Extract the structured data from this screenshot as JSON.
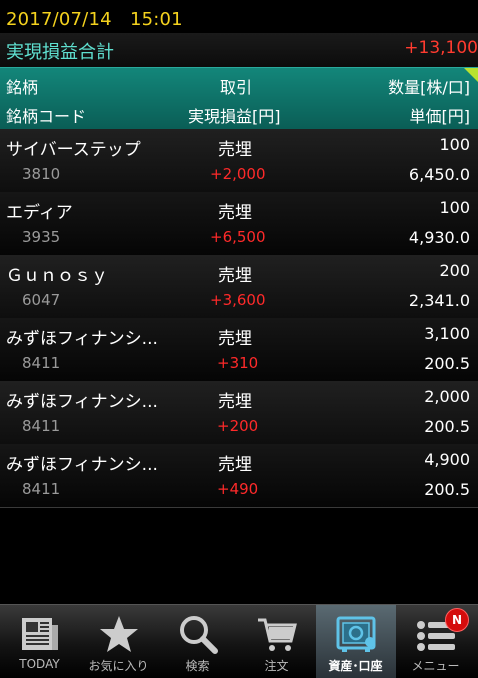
{
  "datetime": "2017/07/14　15:01",
  "summary": {
    "label": "実現損益合計",
    "value": "+13,100"
  },
  "header": {
    "col1_top": "銘柄",
    "col2_top": "取引",
    "col3_top": "数量[株/口]",
    "col1_bottom": "銘柄コード",
    "col2_bottom": "実現損益[円]",
    "col3_bottom": "単価[円]"
  },
  "rows": [
    {
      "name": "サイバーステップ",
      "trade": "売埋",
      "qty": "100",
      "code": "3810",
      "pl": "+2,000",
      "price": "6,450.0"
    },
    {
      "name": "エディア",
      "trade": "売埋",
      "qty": "100",
      "code": "3935",
      "pl": "+6,500",
      "price": "4,930.0"
    },
    {
      "name": "Ｇｕｎｏｓｙ",
      "trade": "売埋",
      "qty": "200",
      "code": "6047",
      "pl": "+3,600",
      "price": "2,341.0"
    },
    {
      "name": "みずほフィナンシ...",
      "trade": "売埋",
      "qty": "3,100",
      "code": "8411",
      "pl": "+310",
      "price": "200.5"
    },
    {
      "name": "みずほフィナンシ...",
      "trade": "売埋",
      "qty": "2,000",
      "code": "8411",
      "pl": "+200",
      "price": "200.5"
    },
    {
      "name": "みずほフィナンシ...",
      "trade": "売埋",
      "qty": "4,900",
      "code": "8411",
      "pl": "+490",
      "price": "200.5"
    }
  ],
  "tabs": [
    {
      "label": "TODAY",
      "icon": "newspaper-icon"
    },
    {
      "label": "お気に入り",
      "icon": "star-icon"
    },
    {
      "label": "検索",
      "icon": "search-icon"
    },
    {
      "label": "注文",
      "icon": "cart-icon"
    },
    {
      "label": "資産･口座",
      "icon": "safe-icon",
      "active": true
    },
    {
      "label": "メニュー",
      "icon": "menu-icon",
      "badge": "N"
    }
  ],
  "colors": {
    "accent_yellow": "#f4d21e",
    "teal_header": "#13867a",
    "profit_red": "#ff2a2a",
    "summary_label": "#5fe0d0"
  }
}
